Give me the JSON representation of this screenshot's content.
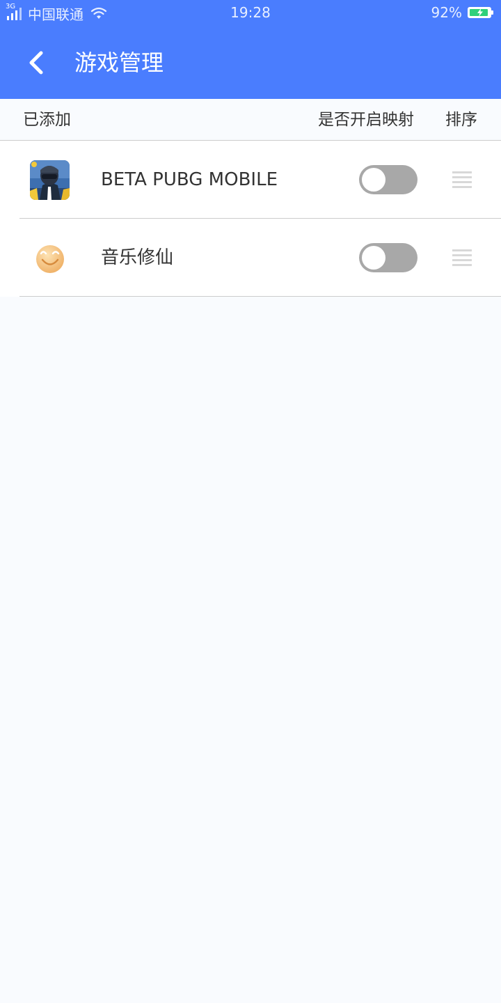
{
  "status_bar": {
    "network": "3G",
    "carrier": "中国联通",
    "time": "19:28",
    "battery_percent": "92%",
    "battery_level": 0.92,
    "icons": [
      "signal-icon",
      "wifi-icon",
      "battery-charging-icon"
    ]
  },
  "app_bar": {
    "title": "游戏管理",
    "back_icon": "chevron-left-icon"
  },
  "list_header": {
    "added": "已添加",
    "mapping": "是否开启映射",
    "sort": "排序"
  },
  "games": [
    {
      "name": "BETA PUBG MOBILE",
      "icon": "pubg-game-icon",
      "mapping_enabled": false
    },
    {
      "name": "音乐修仙",
      "icon": "smiley-game-icon",
      "mapping_enabled": false
    }
  ],
  "colors": {
    "primary": "#4a7dfe",
    "background": "#f9fbfe",
    "toggle_off": "#a8a8a8",
    "battery_fill": "#2fd07b",
    "text": "#333333"
  }
}
